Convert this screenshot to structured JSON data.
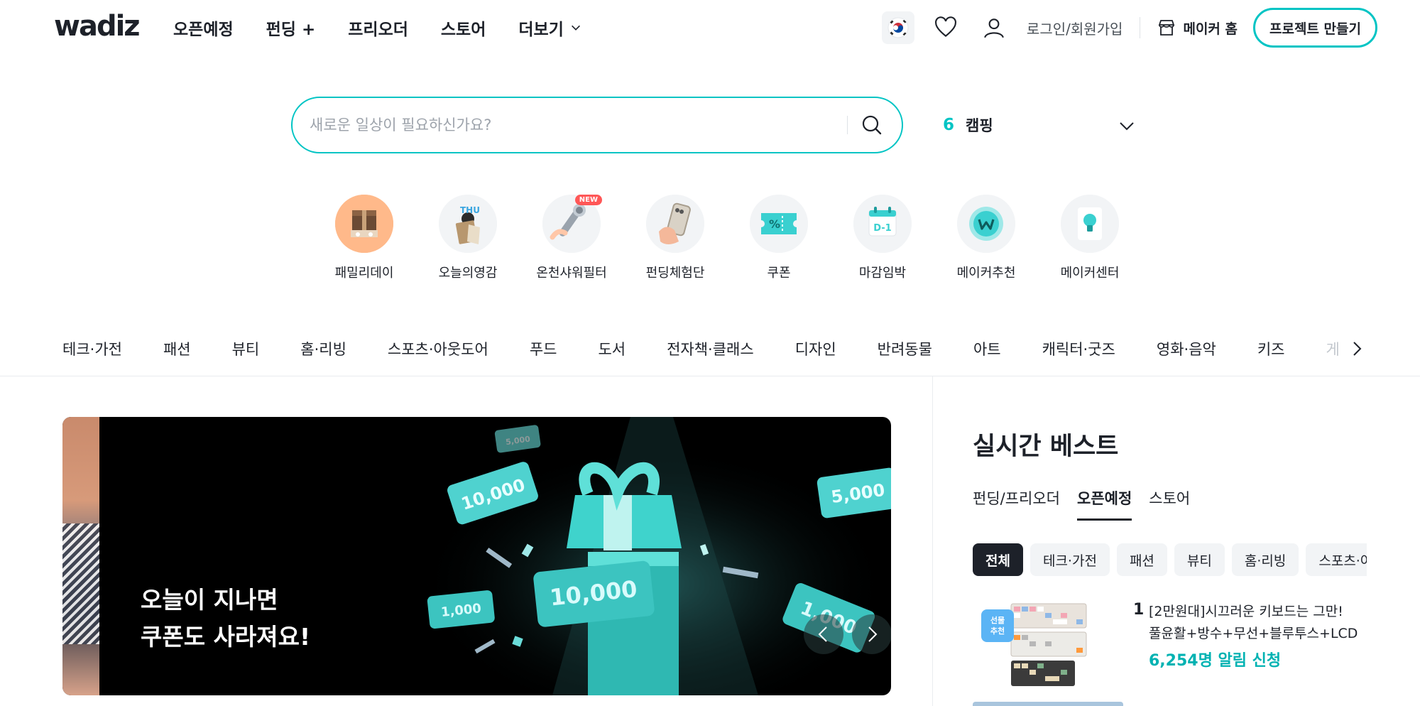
{
  "header": {
    "logo": "wadiz",
    "nav": [
      {
        "label": "오픈예정"
      },
      {
        "label": "펀딩 +"
      },
      {
        "label": "프리오더"
      },
      {
        "label": "스토어"
      },
      {
        "label": "더보기"
      }
    ],
    "login": "로그인/회원가입",
    "maker_home": "메이커 홈",
    "project_button": "프로젝트 만들기"
  },
  "search": {
    "placeholder": "새로운 일상이 필요하신가요?",
    "trending_rank": "6",
    "trending_word": "캠핑"
  },
  "quick_menu": [
    {
      "label": "패밀리데이",
      "icon": "gift-box-icon"
    },
    {
      "label": "오늘의영감",
      "icon": "inspiration-icon"
    },
    {
      "label": "온천샤워필터",
      "icon": "shower-filter-icon",
      "badge": "NEW"
    },
    {
      "label": "펀딩체험단",
      "icon": "phone-hand-icon"
    },
    {
      "label": "쿠폰",
      "icon": "coupon-icon"
    },
    {
      "label": "마감임박",
      "icon": "calendar-d1-icon",
      "calendar_text": "D-1"
    },
    {
      "label": "메이커추천",
      "icon": "wadiz-coin-icon"
    },
    {
      "label": "메이커센터",
      "icon": "lightbulb-icon"
    }
  ],
  "categories": [
    "테크·가전",
    "패션",
    "뷰티",
    "홈·리빙",
    "스포츠·아웃도어",
    "푸드",
    "도서",
    "전자책·클래스",
    "디자인",
    "반려동물",
    "아트",
    "캐릭터·굿즈",
    "영화·음악",
    "키즈",
    "게"
  ],
  "banner": {
    "line1": "오늘이 지나면",
    "line2": "쿠폰도 사라져요!",
    "coupons": [
      "10,000",
      "5,000",
      "10,000",
      "1,000",
      "1,000",
      "5,000"
    ]
  },
  "best": {
    "title": "실시간 베스트",
    "tabs": [
      "펀딩/프리오더",
      "오픈예정",
      "스토어"
    ],
    "active_tab": "오픈예정",
    "chips": [
      "전체",
      "테크·가전",
      "패션",
      "뷰티",
      "홈·리빙",
      "스포츠·아"
    ],
    "items": [
      {
        "rank": "1",
        "badge_line1": "선물",
        "badge_line2": "추천",
        "title_line1": "[2만원대]시끄러운 키보드는 그만!",
        "title_line2": "풀윤활+방수+무선+블루투스+LCD",
        "count": "6,254명 알림 신청"
      }
    ]
  },
  "colors": {
    "accent": "#00c4c4",
    "text": "#1d2129",
    "muted": "#9da3ab",
    "count": "#00b2b2",
    "badge": "#5bb4f5"
  }
}
